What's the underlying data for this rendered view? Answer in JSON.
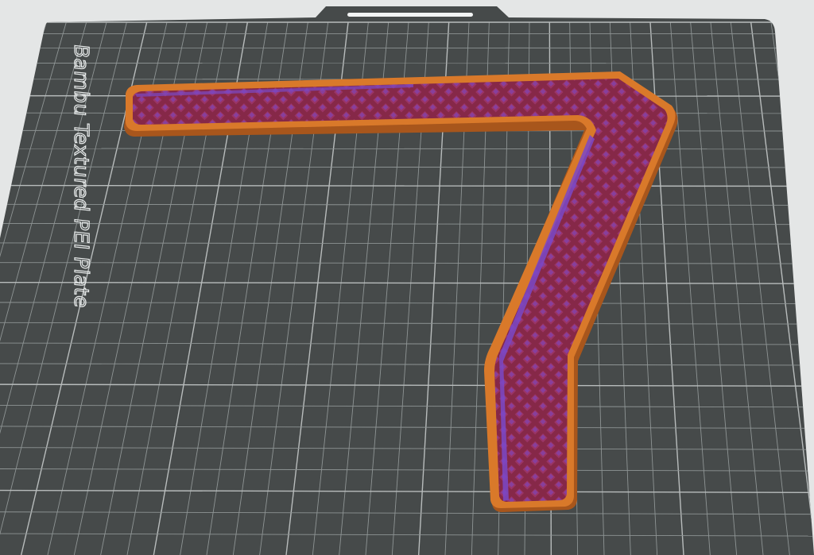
{
  "viewport": {
    "background_color": "#e4e6e6",
    "plate_color": "#464a4a",
    "grid_color": "#8e9494",
    "grid_major_color": "#b8bcbc",
    "handle_color": "#f2f4f4"
  },
  "plate": {
    "label": "Bambu Textured PEI Plate"
  },
  "print_object": {
    "shape": "bent-bar",
    "perimeter_color": "#d9792a",
    "perimeter_edge_color": "#a8561c",
    "infill_color": "#862848",
    "infill_highlight_color": "#7a48c8"
  }
}
